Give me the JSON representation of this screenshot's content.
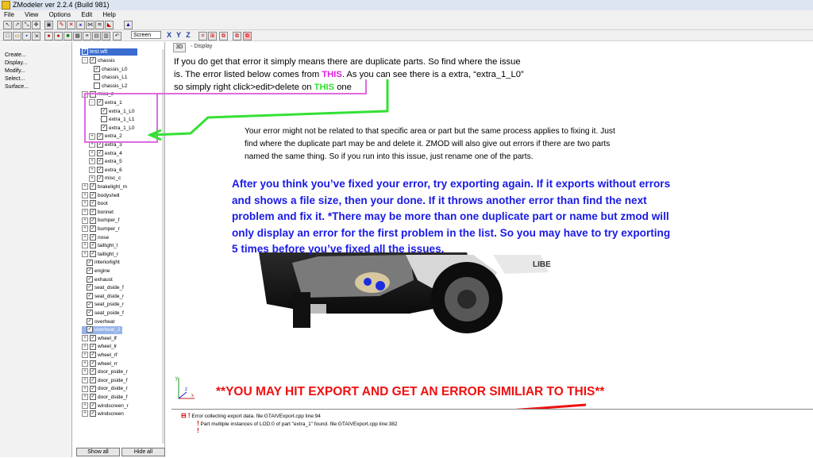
{
  "window": {
    "title": "ZModeler ver 2.2.4 (Build 981)"
  },
  "menu": [
    "File",
    "View",
    "Options",
    "Edit",
    "Help"
  ],
  "toolbar": {
    "display_mode": "Screen",
    "axis_buttons": [
      "X",
      "Y",
      "Z"
    ]
  },
  "commands": [
    "Create...",
    "Display...",
    "Modify...",
    "Select...",
    "Surface..."
  ],
  "tree": {
    "root": "test.wft",
    "nodes": [
      {
        "label": "chassis",
        "level": 1,
        "expander": "-",
        "checked": true
      },
      {
        "label": "chassis_L0",
        "level": 2,
        "expander": "",
        "checked": true
      },
      {
        "label": "chassis_L1",
        "level": 2,
        "expander": "",
        "checked": false
      },
      {
        "label": "chassis_L2",
        "level": 2,
        "expander": "",
        "checked": false
      },
      {
        "label": "misc_z",
        "level": 1,
        "expander": "-",
        "checked": false
      },
      {
        "label": "extra_1",
        "level": 2,
        "expander": "-",
        "checked": true
      },
      {
        "label": "extra_1_L0",
        "level": 3,
        "expander": "",
        "checked": true
      },
      {
        "label": "extra_1_L1",
        "level": 3,
        "expander": "",
        "checked": false
      },
      {
        "label": "extra_1_L0",
        "level": 3,
        "expander": "",
        "checked": true
      },
      {
        "label": "extra_2",
        "level": 2,
        "expander": "+",
        "checked": true
      },
      {
        "label": "extra_3",
        "level": 2,
        "expander": "+",
        "checked": true
      },
      {
        "label": "extra_4",
        "level": 2,
        "expander": "+",
        "checked": true
      },
      {
        "label": "extra_5",
        "level": 2,
        "expander": "+",
        "checked": true
      },
      {
        "label": "extra_6",
        "level": 2,
        "expander": "+",
        "checked": true
      },
      {
        "label": "misc_c",
        "level": 2,
        "expander": "+",
        "checked": true
      },
      {
        "label": "brakelight_m",
        "level": 1,
        "expander": "+",
        "checked": true
      },
      {
        "label": "bodyshell",
        "level": 1,
        "expander": "+",
        "checked": true
      },
      {
        "label": "boot",
        "level": 1,
        "expander": "+",
        "checked": true
      },
      {
        "label": "bonnet",
        "level": 1,
        "expander": "+",
        "checked": true
      },
      {
        "label": "bumper_f",
        "level": 1,
        "expander": "+",
        "checked": true
      },
      {
        "label": "bumper_r",
        "level": 1,
        "expander": "+",
        "checked": true
      },
      {
        "label": "nose",
        "level": 1,
        "expander": "+",
        "checked": true
      },
      {
        "label": "taillight_l",
        "level": 1,
        "expander": "+",
        "checked": true
      },
      {
        "label": "taillight_r",
        "level": 1,
        "expander": "+",
        "checked": true
      },
      {
        "label": "interiorlight",
        "level": 1,
        "expander": "",
        "checked": true
      },
      {
        "label": "engine",
        "level": 1,
        "expander": "",
        "checked": true
      },
      {
        "label": "exhaust",
        "level": 1,
        "expander": "",
        "checked": true
      },
      {
        "label": "seat_dside_f",
        "level": 1,
        "expander": "",
        "checked": true
      },
      {
        "label": "seat_dside_r",
        "level": 1,
        "expander": "",
        "checked": true
      },
      {
        "label": "seat_pside_r",
        "level": 1,
        "expander": "",
        "checked": true
      },
      {
        "label": "seat_pside_f",
        "level": 1,
        "expander": "",
        "checked": true
      },
      {
        "label": "overheat",
        "level": 1,
        "expander": "",
        "checked": true
      },
      {
        "label": "overheat_2",
        "level": 1,
        "expander": "",
        "checked": true,
        "selected": true
      },
      {
        "label": "wheel_lf",
        "level": 1,
        "expander": "+",
        "checked": true
      },
      {
        "label": "wheel_lr",
        "level": 1,
        "expander": "+",
        "checked": true
      },
      {
        "label": "wheel_rf",
        "level": 1,
        "expander": "+",
        "checked": true
      },
      {
        "label": "wheel_rr",
        "level": 1,
        "expander": "+",
        "checked": true
      },
      {
        "label": "door_pside_r",
        "level": 1,
        "expander": "+",
        "checked": true
      },
      {
        "label": "door_pside_f",
        "level": 1,
        "expander": "+",
        "checked": true
      },
      {
        "label": "door_dside_r",
        "level": 1,
        "expander": "+",
        "checked": true
      },
      {
        "label": "door_dside_f",
        "level": 1,
        "expander": "+",
        "checked": true
      },
      {
        "label": "windscreen_r",
        "level": 1,
        "expander": "+",
        "checked": true
      },
      {
        "label": "windscreen",
        "level": 1,
        "expander": "+",
        "checked": true
      }
    ],
    "buttons": {
      "show_all": "Show all",
      "hide_all": "Hide all"
    }
  },
  "viewport": {
    "tab": "3D",
    "label": "Display",
    "car_door_text": "LIBE"
  },
  "annotations": {
    "note1_a": "If you do get that error it simply means there are duplicate parts. So find where the issue is. The error listed below comes from ",
    "note1_this1": "THIS",
    "note1_b": ". As you can see there is a extra, “extra_1_L0” so simply right click>edit>delete on ",
    "note1_this2": "THIS",
    "note1_c": " one",
    "note2": "Your error might not be related to that specific area or part but the same process applies to fixing it. Just find where the duplicate part may be and delete it. ZMOD will also give out errors if there are two parts named the same thing. So if you run into this issue, just rename one of the parts.",
    "note3": "After you think you’ve fixed your error, try exporting again. If it exports without errors and shows a file size, then your done. If it throws another error than find the next problem and fix it. *There may be more than one duplicate part or name but zmod will only display an error for the first problem in the list. So you may have to try exporting 5 times before you’ve fixed all the issues.",
    "warning": "**YOU MAY HIT EXPORT AND GET AN ERROR SIMILIAR TO THIS**"
  },
  "log": {
    "line1": "Error collecting export data. file:GTAIVExport.cpp line:94",
    "line2": "Part multiple instances of LOD:0 of part \"extra_1\" found. file:GTAIVExport.cpp line:382"
  },
  "colors": {
    "pink": "#e020e0",
    "green": "#30e030",
    "blue": "#1a1ae6",
    "red": "#f01010"
  }
}
